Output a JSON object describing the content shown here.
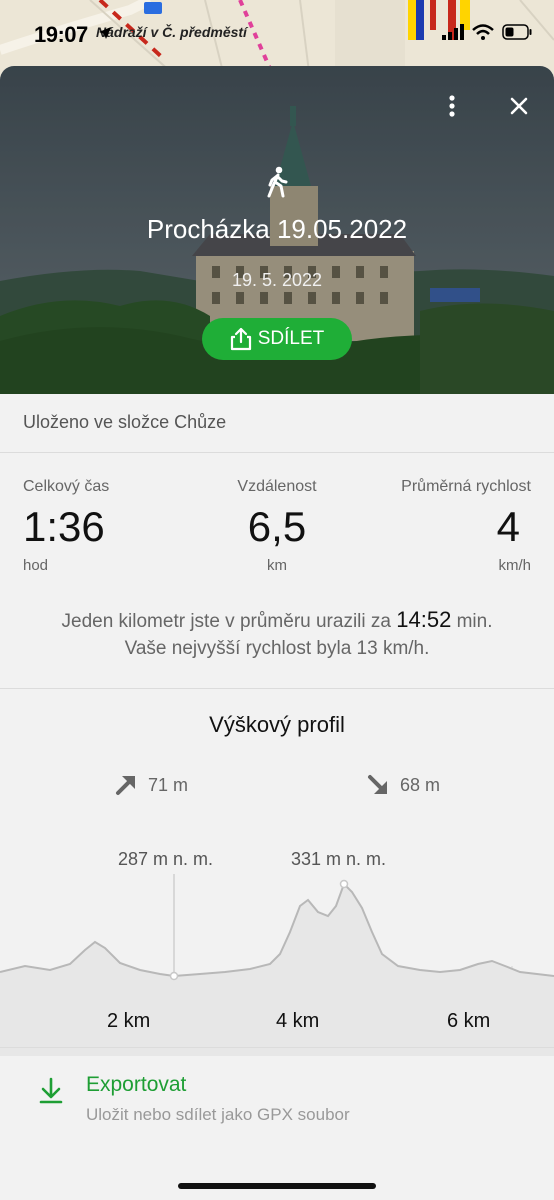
{
  "status_bar": {
    "time": "19:07"
  },
  "map": {
    "label": "Nádraží v Č. předměstí"
  },
  "hero": {
    "title": "Procházka 19.05.2022",
    "date": "19. 5. 2022",
    "share_label": "SDÍLET"
  },
  "folder_text": "Uloženo ve složce Chůze",
  "stats": {
    "time": {
      "label": "Celkový čas",
      "value": "1:36",
      "unit": "hod"
    },
    "distance": {
      "label": "Vzdálenost",
      "value": "6,5",
      "unit": "km"
    },
    "speed": {
      "label": "Průměrná rychlost",
      "value": "4",
      "unit": "km/h"
    }
  },
  "summary": {
    "line1_pre": "Jeden kilometr jste v průměru urazili za",
    "pace": "14:52",
    "line1_post": "min.",
    "line2": "Vaše nejvyšší rychlost byla 13 km/h."
  },
  "profile": {
    "title": "Výškový profil",
    "ascent": "71 m",
    "descent": "68 m",
    "peak1": "287 m n. m.",
    "peak2": "331 m n. m.",
    "km_labels": [
      "2 km",
      "4 km",
      "6 km"
    ]
  },
  "export": {
    "title": "Exportovat",
    "subtitle": "Uložit nebo sdílet jako GPX soubor"
  },
  "colors": {
    "accent_green": "#1fae37",
    "export_green": "#1e9e34"
  }
}
